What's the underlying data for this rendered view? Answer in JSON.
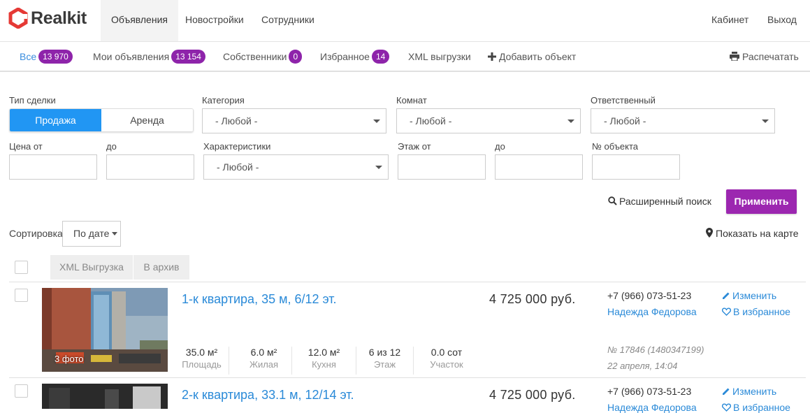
{
  "brand": {
    "name": "Realkit",
    "color": "#e53935"
  },
  "nav": {
    "items": [
      "Объявления",
      "Новостройки",
      "Сотрудники"
    ],
    "right": [
      "Кабинет",
      "Выход"
    ]
  },
  "tabs": [
    {
      "label": "Все",
      "count": "13 970"
    },
    {
      "label": "Мои объявления",
      "count": "13 154"
    },
    {
      "label": "Собственники",
      "count": "0"
    },
    {
      "label": "Избранное",
      "count": "14"
    },
    {
      "label": "XML выгрузки"
    },
    {
      "label": "Добавить объект"
    }
  ],
  "print_label": "Распечатать",
  "filters": {
    "deal_type_label": "Тип сделки",
    "deal_sale": "Продажа",
    "deal_rent": "Аренда",
    "category_label": "Категория",
    "category_value": "- Любой -",
    "rooms_label": "Комнат",
    "rooms_value": "- Любой -",
    "responsible_label": "Ответственный",
    "responsible_value": "- Любой -",
    "price_from_label": "Цена от",
    "price_to_label": "до",
    "features_label": "Характеристики",
    "features_value": "- Любой -",
    "floor_from_label": "Этаж от",
    "floor_to_label": "до",
    "object_no_label": "№ объекта",
    "advanced_search": "Расширенный поиск",
    "apply": "Применить"
  },
  "sort": {
    "label": "Сортировка",
    "value": "По дате"
  },
  "map_link": "Показать на карте",
  "bulk": {
    "xml": "XML Выгрузка",
    "archive": "В архив"
  },
  "listings": [
    {
      "title": "1-к квартира, 35 м, 6/12 эт.",
      "price": "4 725 000 руб.",
      "phone": "+7 (966) 073-51-23",
      "agent": "Надежда Федорова",
      "edit": "Изменить",
      "fav": "В избранное",
      "photos": "3 фото",
      "stats": [
        {
          "v": "35.0 м²",
          "k": "Площадь"
        },
        {
          "v": "6.0 м²",
          "k": "Жилая"
        },
        {
          "v": "12.0 м²",
          "k": "Кухня"
        },
        {
          "v": "6 из 12",
          "k": "Этаж"
        },
        {
          "v": "0.0 сот",
          "k": "Участок"
        }
      ],
      "number": "№ 17846 (1480347199)",
      "date": "22 апреля, 14:04"
    },
    {
      "title": "2-к квартира, 33.1 м, 12/14 эт.",
      "price": "4 725 000 руб.",
      "phone": "+7 (966) 073-51-23",
      "agent": "Надежда Федорова",
      "edit": "Изменить",
      "fav": "В избранное"
    }
  ],
  "colors": {
    "accent": "#2196f3",
    "purple": "#9c27b0",
    "link": "#2a8ad8"
  }
}
